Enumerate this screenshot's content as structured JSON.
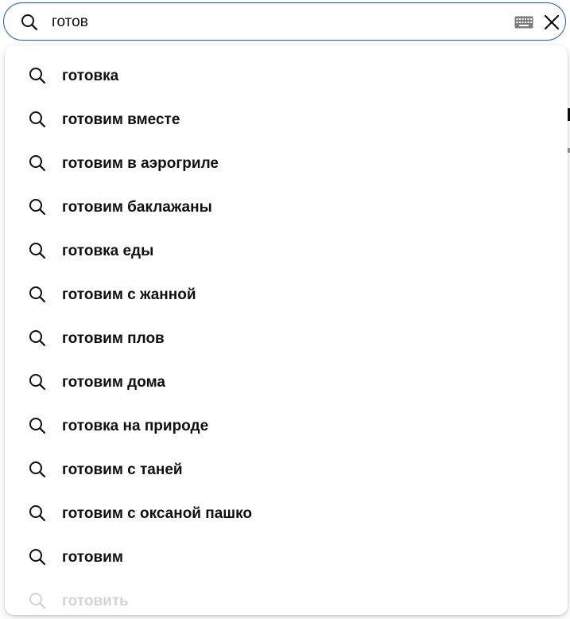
{
  "search": {
    "query": "готов",
    "search_icon": "search-icon",
    "keyboard_icon": "keyboard-icon",
    "clear_icon": "close-icon",
    "accent_color": "#1c62b9"
  },
  "suggestions": [
    {
      "label": "готовка"
    },
    {
      "label": "готовим вместе"
    },
    {
      "label": "готовим в аэрогриле"
    },
    {
      "label": "готовим баклажаны"
    },
    {
      "label": "готовка еды"
    },
    {
      "label": "готовим с жанной"
    },
    {
      "label": "готовим плов"
    },
    {
      "label": "готовим дома"
    },
    {
      "label": "готовка на природе"
    },
    {
      "label": "готовим с таней"
    },
    {
      "label": "готовим с оксаной пашко"
    },
    {
      "label": "готовим"
    },
    {
      "label": "готовить"
    }
  ]
}
